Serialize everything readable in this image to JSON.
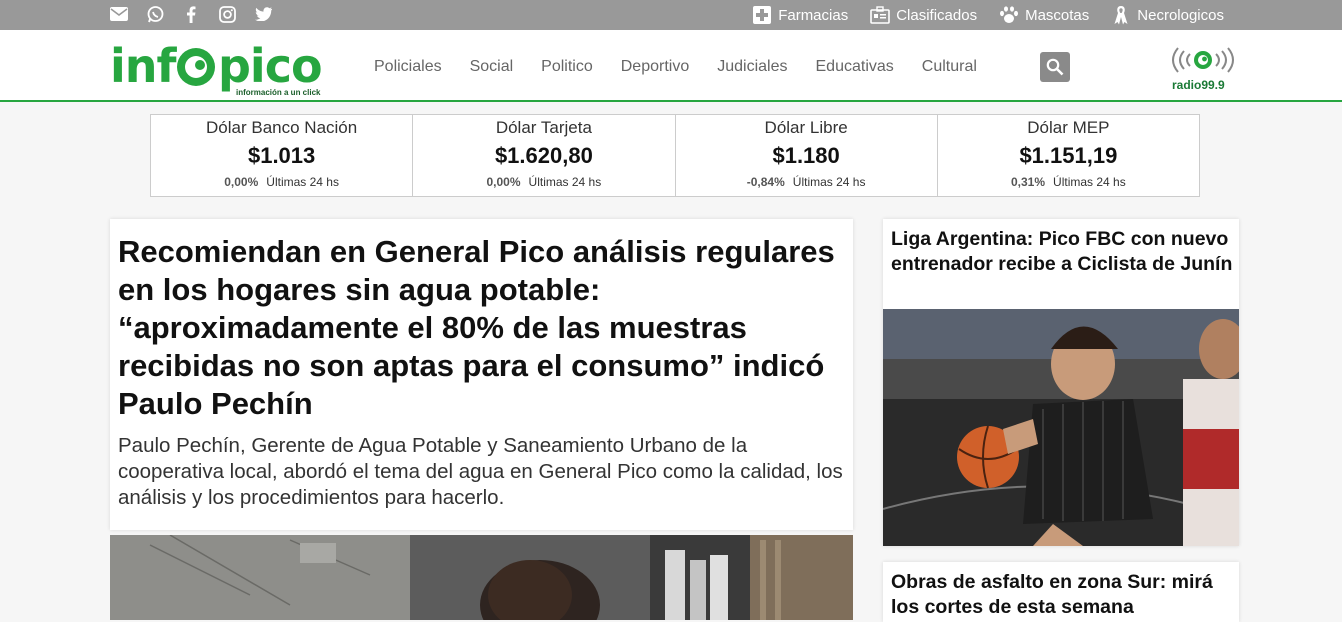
{
  "topbar": {
    "social": [
      {
        "name": "mail-icon"
      },
      {
        "name": "whatsapp-icon"
      },
      {
        "name": "facebook-icon"
      },
      {
        "name": "instagram-icon"
      },
      {
        "name": "twitter-icon"
      }
    ],
    "links": [
      {
        "label": "Farmacias",
        "icon": "pharmacy-cross-icon"
      },
      {
        "label": "Clasificados",
        "icon": "classifieds-icon"
      },
      {
        "label": "Mascotas",
        "icon": "paw-icon"
      },
      {
        "label": "Necrologicos",
        "icon": "ribbon-icon"
      }
    ]
  },
  "header": {
    "logo_text": "infopico",
    "logo_tagline": "información a un click",
    "nav": [
      "Policiales",
      "Social",
      "Politico",
      "Deportivo",
      "Judiciales",
      "Educativas",
      "Cultural"
    ],
    "radio_label": "radio99.9"
  },
  "dollar": [
    {
      "name": "Dólar Banco Nación",
      "value": "$1.013",
      "pct": "0,00%",
      "period": "Últimas 24 hs"
    },
    {
      "name": "Dólar Tarjeta",
      "value": "$1.620,80",
      "pct": "0,00%",
      "period": "Últimas 24 hs"
    },
    {
      "name": "Dólar Libre",
      "value": "$1.180",
      "pct": "-0,84%",
      "period": "Últimas 24 hs"
    },
    {
      "name": "Dólar MEP",
      "value": "$1.151,19",
      "pct": "0,31%",
      "period": "Últimas 24 hs"
    }
  ],
  "main_article": {
    "title": "Recomiendan en General Pico análisis regulares en los hogares sin agua potable: “aproximadamente el 80% de las muestras recibidas no son aptas para el consumo” indicó Paulo Pechín",
    "summary": "Paulo Pechín, Gerente de Agua Potable y Saneamiento Urbano de la cooperativa local, abordó el tema del agua en General Pico como la calidad, los análisis y los procedimientos para hacerlo."
  },
  "side_articles": [
    {
      "title": "Liga Argentina: Pico FBC con nuevo entrenador recibe a Ciclista de Junín"
    },
    {
      "title": "Obras de asfalto en zona Sur: mirá los cortes de esta semana"
    }
  ],
  "colors": {
    "brand_green": "#27a640",
    "topbar_gray": "#999999"
  }
}
